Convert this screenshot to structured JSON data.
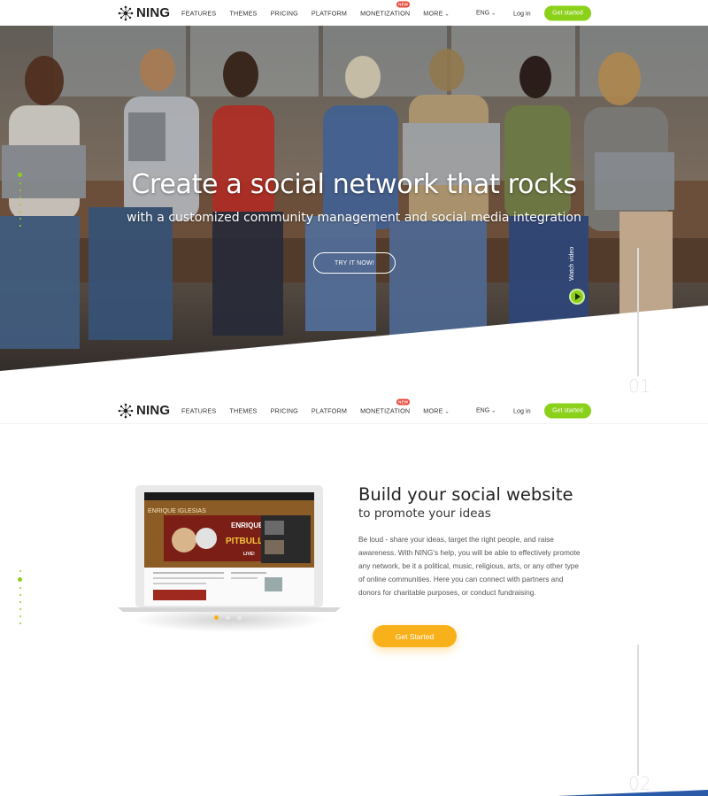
{
  "brand": {
    "name": "NING",
    "accent": "#8bd11a",
    "cta_orange": "#f9b11b",
    "badge_red": "#e84a3b"
  },
  "nav": {
    "items": [
      {
        "label": "FEATURES"
      },
      {
        "label": "THEMES"
      },
      {
        "label": "PRICING"
      },
      {
        "label": "PLATFORM"
      },
      {
        "label": "MONETIZATION",
        "badge": "NEW"
      },
      {
        "label": "MORE"
      }
    ],
    "language": "ENG",
    "login": "Log in",
    "cta": "Get started"
  },
  "hero": {
    "title": "Create a social network that rocks",
    "subtitle": "with a customized community management and social media integration",
    "button": "TRY IT NOW!",
    "watch_video": "Watch video",
    "section_number": "01"
  },
  "section2": {
    "title": "Build your social website",
    "subtitle": "to promote your ideas",
    "body": "Be loud - share your ideas, target the right people, and raise awareness. With NING's help, you will be able to effectively promote any network, be it a political, music, religious, arts, or any other type of online communities. Here you can connect with partners and donors for charitable purposes, or conduct fundraising.",
    "button": "Get Started",
    "section_number": "02",
    "carousel": {
      "count": 3,
      "active_index": 0
    },
    "screen": {
      "header": "ENRIQUE IGLESIAS",
      "poster_name": "ENRIQUE",
      "poster_guest": "PITBULL",
      "poster_tag": "LIVE!"
    }
  }
}
